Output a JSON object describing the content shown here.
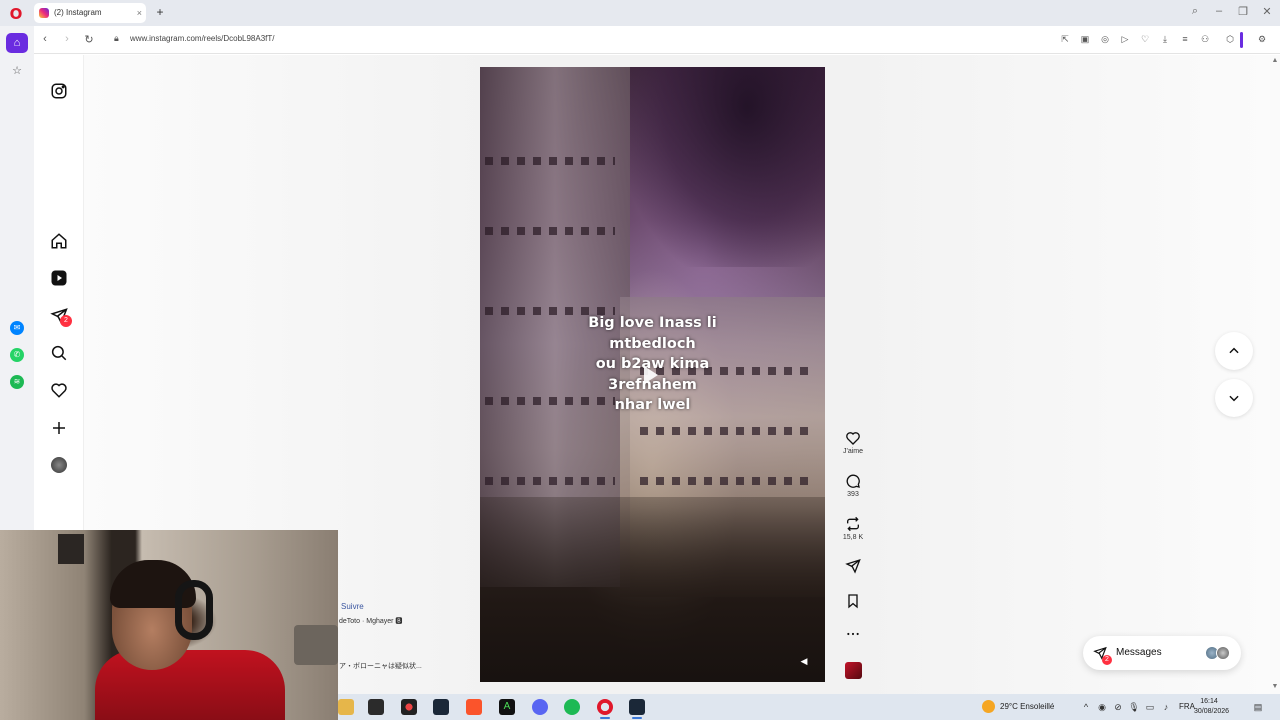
{
  "browser": {
    "tab": {
      "title": "(2) Instagram",
      "close": "×"
    },
    "new_tab": "+",
    "url": "www.instagram.com/reels/DcobL98A3fT/",
    "window_controls": [
      "search-icon",
      "minimize-icon",
      "restore-icon",
      "close-icon"
    ],
    "accent": "#6a2ce0"
  },
  "opera_sidebar": {
    "items": [
      "home-icon",
      "star-icon",
      "messenger-icon",
      "whatsapp-icon",
      "spotify-icon"
    ]
  },
  "instagram": {
    "nav": {
      "notification_badge": "2"
    },
    "reel": {
      "caption": "Big love Inass li\nmtbedloch\nou b2aw kima\n3refnahem\nnhar lwel"
    },
    "actions": {
      "like_label": "J'aime",
      "comments_count": "393",
      "reposts_count": "15,8 K"
    },
    "messages": {
      "label": "Messages",
      "badge": "2"
    }
  },
  "side_text": {
    "follow": "Suivre",
    "author": "deToto · Mghayer 🅱",
    "japanese": "ア・ボローニャは疑似状..."
  },
  "taskbar": {
    "weather": "29°C  Ensoleillé",
    "language": "FRA",
    "time": "16:14",
    "date": "30/08/2026"
  }
}
